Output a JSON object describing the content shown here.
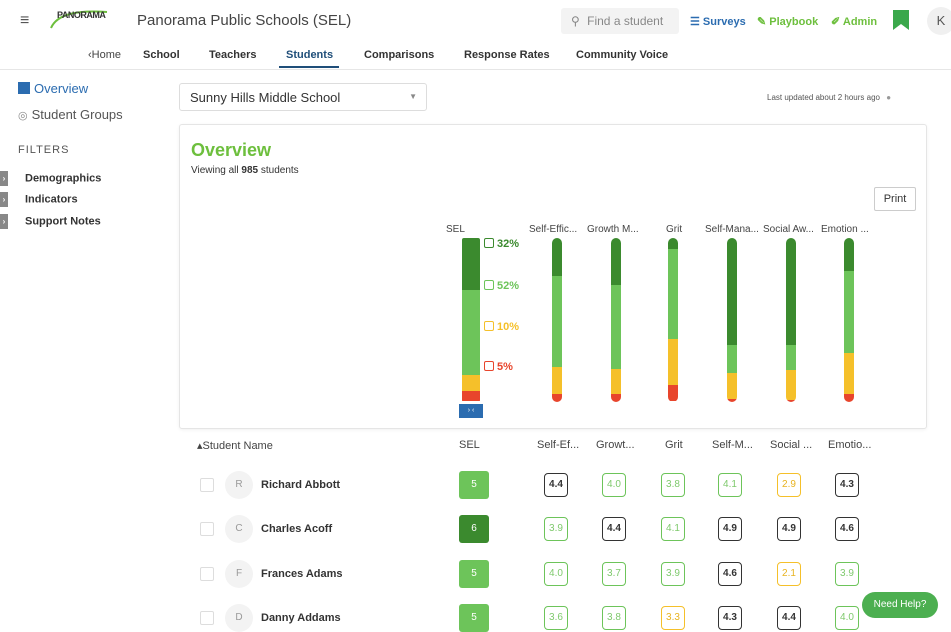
{
  "topbar": {
    "logo_text": "PANORAMA",
    "title": "Panorama Public Schools (SEL)",
    "search_placeholder": "Find a student",
    "surveys": "Surveys",
    "playbook": "Playbook",
    "admin": "Admin",
    "user_initial": "K"
  },
  "subnav": {
    "home": "‹Home",
    "tabs": [
      "School",
      "Teachers",
      "Students",
      "Comparisons",
      "Response Rates",
      "Community Voice"
    ],
    "active": "Students"
  },
  "sidebar": {
    "overview": "Overview",
    "student_groups": "Student Groups",
    "filters_heading": "FILTERS",
    "filters": [
      "Demographics",
      "Indicators",
      "Support Notes"
    ]
  },
  "school_select": {
    "value": "Sunny Hills Middle School"
  },
  "last_updated": "Last updated about 2 hours ago",
  "overview": {
    "title": "Overview",
    "subtitle_prefix": "Viewing all ",
    "student_count": "985",
    "subtitle_suffix": " students",
    "print": "Print"
  },
  "colors": {
    "dark_green": "#3b8a2e",
    "green": "#6dc45a",
    "yellow": "#f5c02a",
    "red": "#e8452c"
  },
  "distribution": {
    "columns": [
      "SEL",
      "Self-Effic...",
      "Growth M...",
      "Grit",
      "Self-Mana...",
      "Social Aw...",
      "Emotion ..."
    ],
    "sel_percentages": [
      "32%",
      "52%",
      "10%",
      "5%"
    ],
    "bars": [
      [
        32,
        52,
        10,
        6
      ],
      [
        25,
        60,
        18,
        5
      ],
      [
        30,
        53,
        16,
        5
      ],
      [
        7,
        55,
        28,
        10
      ],
      [
        65,
        17,
        16,
        2
      ],
      [
        65,
        15,
        18,
        2
      ],
      [
        20,
        50,
        25,
        5
      ]
    ]
  },
  "table": {
    "headers": [
      "Student Name",
      "SEL",
      "Self-Ef...",
      "Growt...",
      "Grit",
      "Self-M...",
      "Social ...",
      "Emotio..."
    ],
    "rows": [
      {
        "initial": "R",
        "name": "Richard Abbott",
        "sel": "5",
        "scores": [
          "4.4",
          "4.0",
          "3.8",
          "4.1",
          "2.9",
          "4.3"
        ]
      },
      {
        "initial": "C",
        "name": "Charles Acoff",
        "sel": "6",
        "scores": [
          "3.9",
          "4.4",
          "4.1",
          "4.9",
          "4.9",
          "4.6"
        ]
      },
      {
        "initial": "F",
        "name": "Frances Adams",
        "sel": "5",
        "scores": [
          "4.0",
          "3.7",
          "3.9",
          "4.6",
          "2.1",
          "3.9"
        ]
      },
      {
        "initial": "D",
        "name": "Danny Addams",
        "sel": "5",
        "scores": [
          "3.6",
          "3.8",
          "3.3",
          "4.3",
          "4.4",
          "4.0"
        ]
      }
    ]
  },
  "need_help": "Need Help?"
}
